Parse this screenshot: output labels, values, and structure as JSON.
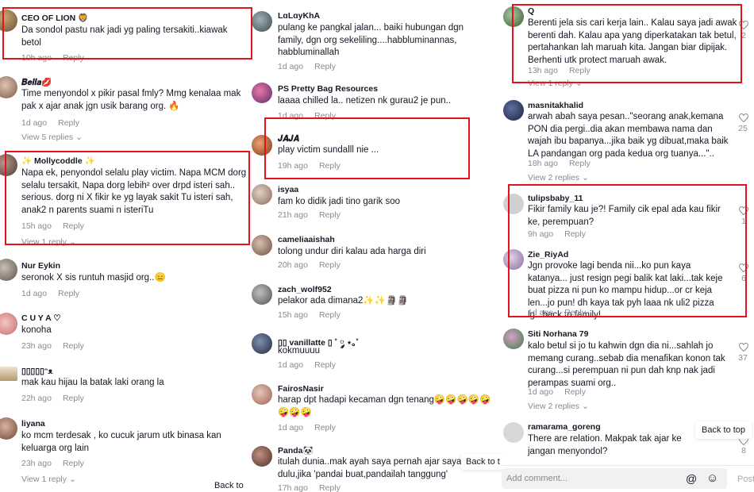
{
  "reply_label": "Reply",
  "col1": [
    {
      "user": "CEO OF LION 🦁",
      "text": "Da sondol pastu nak jadi yg paling tersakiti..kiawak betol",
      "time": "10h ago"
    },
    {
      "user": "𝑩𝒆𝒍𝒍𝒂💋",
      "text": "Time menyondol x pikir pasal fmly? Mmg kenalaa mak pak x ajar anak jgn usik barang org. 🔥",
      "time": "1d ago",
      "replies": "View 5 replies"
    },
    {
      "user": "✨ Mollycoddle ✨",
      "text": "Napa ek, penyondol selalu play victim. Napa MCM dorg selalu tersakit, Napa dorg lebih² over drpd isteri sah.. serious. dorg ni X fikir ke yg layak sakit Tu isteri sah, anak2 n parents suami n isteriTu",
      "time": "15h ago",
      "replies": "View 1 reply"
    },
    {
      "user": "Nur Eykin",
      "text": "seronok X sis runtuh masjid org..😑",
      "time": "1d ago"
    },
    {
      "user": "C U Y A ♡",
      "text": "konoha",
      "time": "23h ago"
    },
    {
      "user": "▯▯▯▯▯ᵔᴥ",
      "text": "mak kau hijau la batak laki orang la",
      "time": "22h ago"
    },
    {
      "user": "liyana",
      "text": "ko mcm terdesak , ko cucuk jarum utk binasa kan keluarga org lain",
      "time": "23h ago",
      "replies": "View 1 reply"
    }
  ],
  "col2": [
    {
      "user": "LɑLɑyKhA",
      "text": "pulang ke pangkal jalan... baiki hubungan dgn family, dgn org sekeliling....habbluminannas, habbluminallah",
      "time": "1d ago"
    },
    {
      "user": "PS Pretty Bag Resources",
      "text": "laaaa chilled la.. netizen nk gurau2 je pun..",
      "time": "1d ago"
    },
    {
      "user": "𝑱𝑨𝑱𝑨",
      "text": "play victim sundalll nie ...",
      "time": "19h ago"
    },
    {
      "user": "isyaa",
      "text": "fam ko didik jadi tino garik soo",
      "time": "21h ago"
    },
    {
      "user": "cameliaaishah",
      "text": "tolong undur diri kalau ada harga diri",
      "time": "20h ago"
    },
    {
      "user": "zach_wolf952",
      "text": "pelakor ada dimana2✨✨🗿🗿",
      "time": "15h ago"
    },
    {
      "user": "▯▯ vanillatte ▯ ˚ ༘ ⋆｡˚",
      "text": "kokmuuuu",
      "time": "1d ago"
    },
    {
      "user": "FairosNasir",
      "text": "harap dpt hadapi kecaman dgn tenang🤪🤪🤪🤪🤪🤪🤪🤪",
      "time": "1d ago"
    },
    {
      "user": "Panda🐼",
      "text": "itulah dunia..mak ayah saya pernah ajar saya dulu,jika 'pandai buat,pandailah tanggung'",
      "time": "17h ago"
    }
  ],
  "col3": [
    {
      "user": "Q",
      "text": "Berenti jela sis cari kerja lain.. Kalau saya jadi awak berenti dah. Kalau apa yang diperkatakan tak betul, pertahankan lah maruah kita. Jangan biar dipijak. Berhenti utk protect maruah awak.",
      "time": "13h ago",
      "likes": "2",
      "replies": "View 1 reply"
    },
    {
      "user": "masnitakhalid",
      "text": "arwah abah saya pesan..\"seorang anak,kemana PON dia pergi..dia akan membawa nama dan wajah ibu bapanya...jika baik yg dibuat,maka baik LA pandangan org pada kedua org tuanya...\"..",
      "time": "18h ago",
      "likes": "25",
      "replies": "View 2 replies"
    },
    {
      "user": "tulipsbaby_11",
      "text": "Fikir family kau je?! Family cik epal ada kau fikir ke, perempuan?",
      "time": "9h ago",
      "likes": "1"
    },
    {
      "user": "Zie_RiyAd",
      "text": "Jgn provoke lagi benda nii...ko pun kaya katanya... just resign pegi balik kat laki...tak keje buat pizza ni pun ko mampu hidup...or cr keja len...jo pun! dh kaya tak pyh laaa nk uli2 pizza lg...back to family!",
      "time": "1d ago",
      "likes": "6"
    },
    {
      "user": "Siti Norhana 79",
      "text": "kalo betul si jo tu kahwin dgn dia ni...sahlah jo memang curang..sebab dia menafikan konon tak curang...si perempuan ni pun dah knp nak jadi perampas suami org..",
      "time": "1d ago",
      "likes": "37",
      "replies": "View 2 replies"
    },
    {
      "user": "ramarama_goreng",
      "text": "There are relation. Makpak tak ajar ke jangan menyondol?",
      "time": "",
      "likes": "8"
    }
  ],
  "back_to_top": "Back to top",
  "back_to_top_partial_1": "Back to t",
  "back_to_top_partial_2": "Back to",
  "comment_placeholder": "Add comment...",
  "post_label": "Post"
}
